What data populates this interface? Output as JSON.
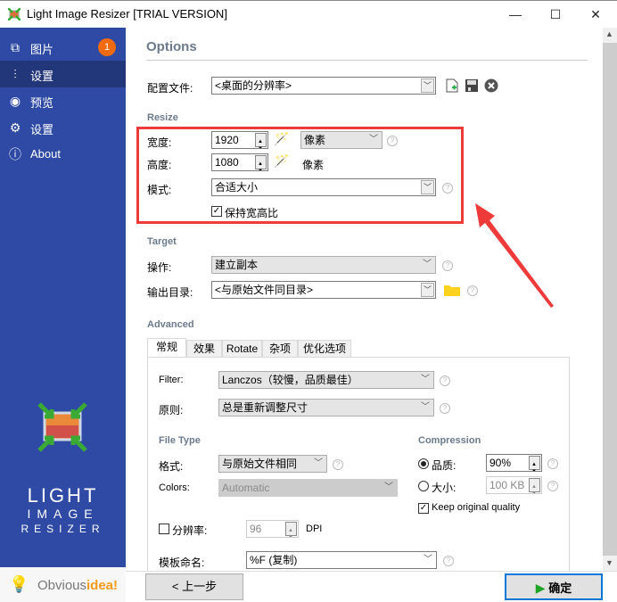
{
  "window": {
    "title": "Light Image Resizer  [TRIAL VERSION]",
    "minimize_glyph": "—",
    "maximize_glyph": "☐",
    "close_glyph": "✕"
  },
  "sidebar": {
    "items": [
      {
        "label": "图片",
        "icon": "images-icon",
        "glyph": "⧉",
        "badge": "1",
        "active": false
      },
      {
        "label": "设置",
        "icon": "sliders-icon",
        "glyph": "⫶",
        "active": true
      },
      {
        "label": "预览",
        "icon": "eye-icon",
        "glyph": "◉",
        "active": false
      },
      {
        "label": "设置",
        "icon": "gear-icon",
        "glyph": "⚙",
        "active": false
      },
      {
        "label": "About",
        "icon": "info-icon",
        "glyph": "ⓘ",
        "active": false
      }
    ],
    "brand_line1": "LIGHT",
    "brand_line2": "IMAGE",
    "brand_line3": "RESIZER",
    "footer_logo_text_a": "Obvious",
    "footer_logo_text_b": "idea!"
  },
  "options": {
    "title": "Options",
    "profile_label": "配置文件:",
    "profile_value": "<桌面的分辨率>"
  },
  "resize": {
    "section": "Resize",
    "width_label": "宽度:",
    "width_value": "1920",
    "unit_value": "像素",
    "height_label": "高度:",
    "height_value": "1080",
    "height_unit": "像素",
    "mode_label": "模式:",
    "mode_value": "合适大小",
    "keep_ratio_label": "保持宽高比",
    "keep_ratio_checked": true
  },
  "target": {
    "section": "Target",
    "action_label": "操作:",
    "action_value": "建立副本",
    "output_label": "输出目录:",
    "output_value": "<与原始文件同目录>"
  },
  "advanced": {
    "section": "Advanced",
    "tabs": [
      "常规",
      "效果",
      "Rotate",
      "杂项",
      "优化选项"
    ],
    "active_tab": 0,
    "filter_label": "Filter:",
    "filter_value": "Lanczos（较慢，品质最佳）",
    "rule_label": "原则:",
    "rule_value": "总是重新调整尺寸",
    "filetype_section": "File Type",
    "format_label": "格式:",
    "format_value": "与原始文件相同",
    "colors_label": "Colors:",
    "colors_value": "Automatic",
    "compression_section": "Compression",
    "quality_label": "品质:",
    "quality_value": "90%",
    "quality_selected": true,
    "size_label": "大小:",
    "size_value": "100 KB",
    "keep_quality_label": "Keep original quality",
    "keep_quality_checked": true,
    "resolution_label": "分辨率:",
    "resolution_checked": false,
    "resolution_value": "96",
    "resolution_unit": "DPI",
    "naming_label": "模板命名:",
    "naming_value": "%F (复制)"
  },
  "buttons": {
    "back": "< 上一步",
    "ok": "确定"
  },
  "colors": {
    "sidebar": "#2e4aa4",
    "sidebar_active": "#22367a",
    "badge": "#f06a10",
    "annotation": "#ef3a3a",
    "ok_border": "#0078d7"
  }
}
